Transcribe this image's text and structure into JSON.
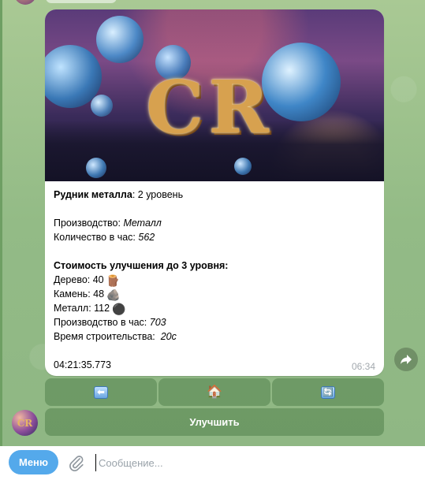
{
  "message": {
    "title_bold": "Рудник металла",
    "title_rest": ": 2 уровень",
    "production_label": "Производство: ",
    "production_value": "Металл",
    "per_hour_label": "Количество в час: ",
    "per_hour_value": "562",
    "upgrade_heading": "Стоимость улучшения до 3 уровня:",
    "wood": "Дерево: 40",
    "stone": "Камень: 48",
    "metal": "Металл: 112",
    "prod_per_hour_label": "Производство в час: ",
    "prod_per_hour_value": "703",
    "build_time_label": "Время строительства:  ",
    "build_time_value": "20с",
    "timer": "04:21:35.773",
    "time": "06:34",
    "image_logo": "CR"
  },
  "keyboard": {
    "row1": [
      {
        "name": "back",
        "glyph": "⬅"
      },
      {
        "name": "home",
        "glyph": "🏠"
      },
      {
        "name": "refresh",
        "glyph": "🔄"
      }
    ],
    "upgrade_label": "Улучшить"
  },
  "avatar_text": "CR",
  "composer": {
    "menu_label": "Меню",
    "placeholder": "Сообщение..."
  },
  "colors": {
    "accent": "#54a9eb",
    "bubble": "#ffffff",
    "keyboard_button": "#6a9a62",
    "chat_background": "#9bc18c"
  },
  "icons": {
    "wood": "wood-icon",
    "stone": "rock-icon",
    "metal": "black-circle-icon",
    "share": "share-arrow-icon",
    "attach": "paperclip-icon"
  }
}
